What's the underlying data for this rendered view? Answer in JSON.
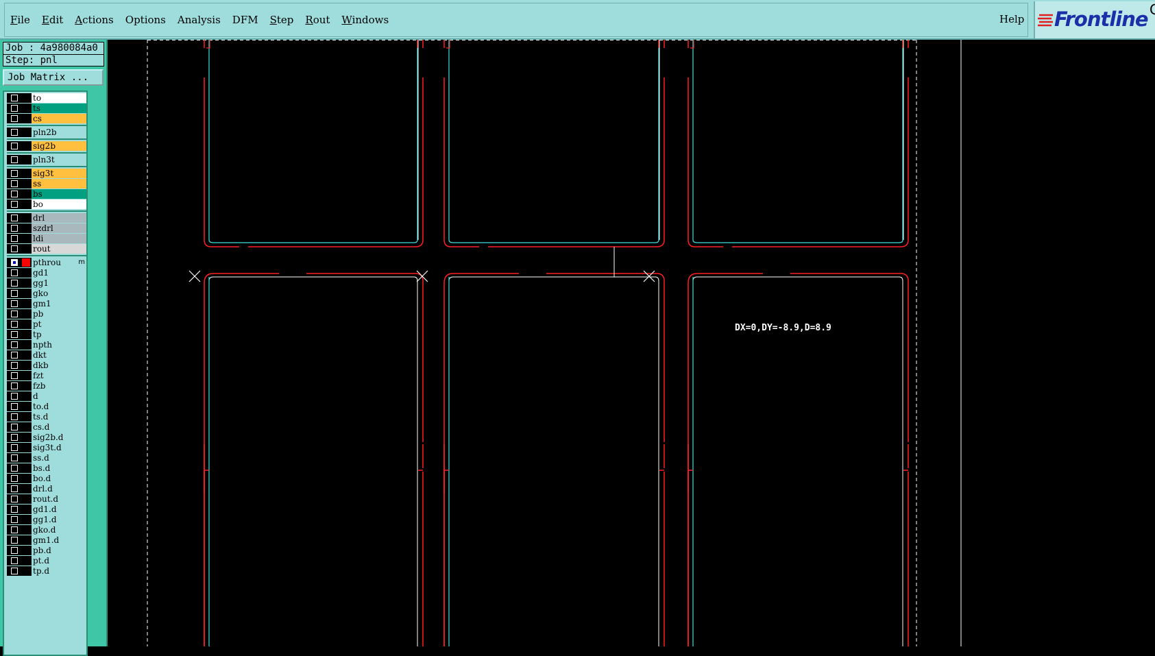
{
  "menubar": {
    "items": [
      {
        "label": "File",
        "ul": "F",
        "rest": "ile"
      },
      {
        "label": "Edit",
        "ul": "E",
        "rest": "dit"
      },
      {
        "label": "Actions",
        "ul": "A",
        "rest": "ctions"
      },
      {
        "label": "Options",
        "ul": "",
        "rest": "Options"
      },
      {
        "label": "Analysis",
        "ul": "",
        "rest": "Analysis"
      },
      {
        "label": "DFM",
        "ul": "",
        "rest": "DFM"
      },
      {
        "label": "Step",
        "ul": "S",
        "rest": "tep"
      },
      {
        "label": "Rout",
        "ul": "R",
        "rest": "out"
      },
      {
        "label": "Windows",
        "ul": "W",
        "rest": "indows"
      }
    ],
    "help": "Help"
  },
  "logo": {
    "text": "Frontline",
    "extra": "C"
  },
  "job": {
    "job_line": "Job : 4a980084a0",
    "step_line": "Step: pnl",
    "matrix_button": "Job Matrix ..."
  },
  "layers": [
    {
      "name": "to",
      "color": "#ffffff"
    },
    {
      "name": "ts",
      "color": "#00a080"
    },
    {
      "name": "cs",
      "color": "#ffc040"
    },
    {
      "name": "pln2b",
      "color": "#9fdddd"
    },
    {
      "name": "sig2b",
      "color": "#ffc040"
    },
    {
      "name": "pln3t",
      "color": "#9fdddd"
    },
    {
      "name": "sig3t",
      "color": "#ffc040"
    },
    {
      "name": "ss",
      "color": "#ffc040"
    },
    {
      "name": "bs",
      "color": "#00a080"
    },
    {
      "name": "bo",
      "color": "#ffffff"
    },
    {
      "name": "drl",
      "color": "#a8b8bc"
    },
    {
      "name": "szdrl",
      "color": "#a8b8bc"
    },
    {
      "name": "ldi",
      "color": "#a8b8bc"
    },
    {
      "name": "rout",
      "color": "#d8d8d8"
    },
    {
      "name": "pthrou",
      "color": "#9fdddd",
      "active": true,
      "mark": "m"
    },
    {
      "name": "gd1",
      "color": "#9fdddd"
    },
    {
      "name": "gg1",
      "color": "#9fdddd"
    },
    {
      "name": "gko",
      "color": "#9fdddd"
    },
    {
      "name": "gm1",
      "color": "#9fdddd"
    },
    {
      "name": "pb",
      "color": "#9fdddd"
    },
    {
      "name": "pt",
      "color": "#9fdddd"
    },
    {
      "name": "tp",
      "color": "#9fdddd"
    },
    {
      "name": "npth",
      "color": "#9fdddd"
    },
    {
      "name": "dkt",
      "color": "#9fdddd"
    },
    {
      "name": "dkb",
      "color": "#9fdddd"
    },
    {
      "name": "fzt",
      "color": "#9fdddd"
    },
    {
      "name": "fzb",
      "color": "#9fdddd"
    },
    {
      "name": "d",
      "color": "#9fdddd"
    },
    {
      "name": "to.d",
      "color": "#9fdddd"
    },
    {
      "name": "ts.d",
      "color": "#9fdddd"
    },
    {
      "name": "cs.d",
      "color": "#9fdddd"
    },
    {
      "name": "sig2b.d",
      "color": "#9fdddd"
    },
    {
      "name": "sig3t.d",
      "color": "#9fdddd"
    },
    {
      "name": "ss.d",
      "color": "#9fdddd"
    },
    {
      "name": "bs.d",
      "color": "#9fdddd"
    },
    {
      "name": "bo.d",
      "color": "#9fdddd"
    },
    {
      "name": "drl.d",
      "color": "#9fdddd"
    },
    {
      "name": "rout.d",
      "color": "#9fdddd"
    },
    {
      "name": "gd1.d",
      "color": "#9fdddd"
    },
    {
      "name": "gg1.d",
      "color": "#9fdddd"
    },
    {
      "name": "gko.d",
      "color": "#9fdddd"
    },
    {
      "name": "gm1.d",
      "color": "#9fdddd"
    },
    {
      "name": "pb.d",
      "color": "#9fdddd"
    },
    {
      "name": "pt.d",
      "color": "#9fdddd"
    },
    {
      "name": "tp.d",
      "color": "#9fdddd"
    }
  ],
  "canvas": {
    "measurement": "DX=0,DY=-8.9,D=8.9",
    "colors": {
      "outline": "#ff2020",
      "cyan": "#40e0e0",
      "white": "#ffffff"
    }
  }
}
